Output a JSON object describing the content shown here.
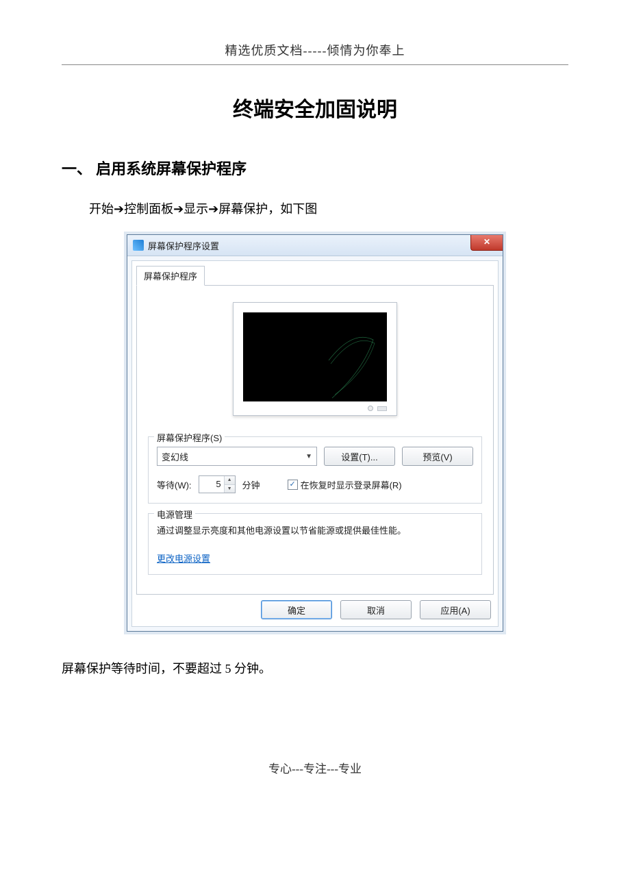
{
  "doc": {
    "header": "精选优质文档-----倾情为你奉上",
    "title": "终端安全加固说明",
    "section1_title": "一、 启用系统屏幕保护程序",
    "path_text": "开始➔控制面板➔显示➔屏幕保护，如下图",
    "caption": "屏幕保护等待时间，不要超过 5 分钟。",
    "footer": "专心---专注---专业"
  },
  "dialog": {
    "title": "屏幕保护程序设置",
    "tab": "屏幕保护程序",
    "group1_label": "屏幕保护程序(S)",
    "dropdown_value": "变幻线",
    "settings_btn": "设置(T)...",
    "preview_btn": "预览(V)",
    "wait_label": "等待(W):",
    "wait_value": "5",
    "wait_unit": "分钟",
    "resume_checkbox": "在恢复时显示登录屏幕(R)",
    "group2_label": "电源管理",
    "power_text": "通过调整显示亮度和其他电源设置以节省能源或提供最佳性能。",
    "power_link": "更改电源设置",
    "ok_btn": "确定",
    "cancel_btn": "取消",
    "apply_btn": "应用(A)"
  }
}
